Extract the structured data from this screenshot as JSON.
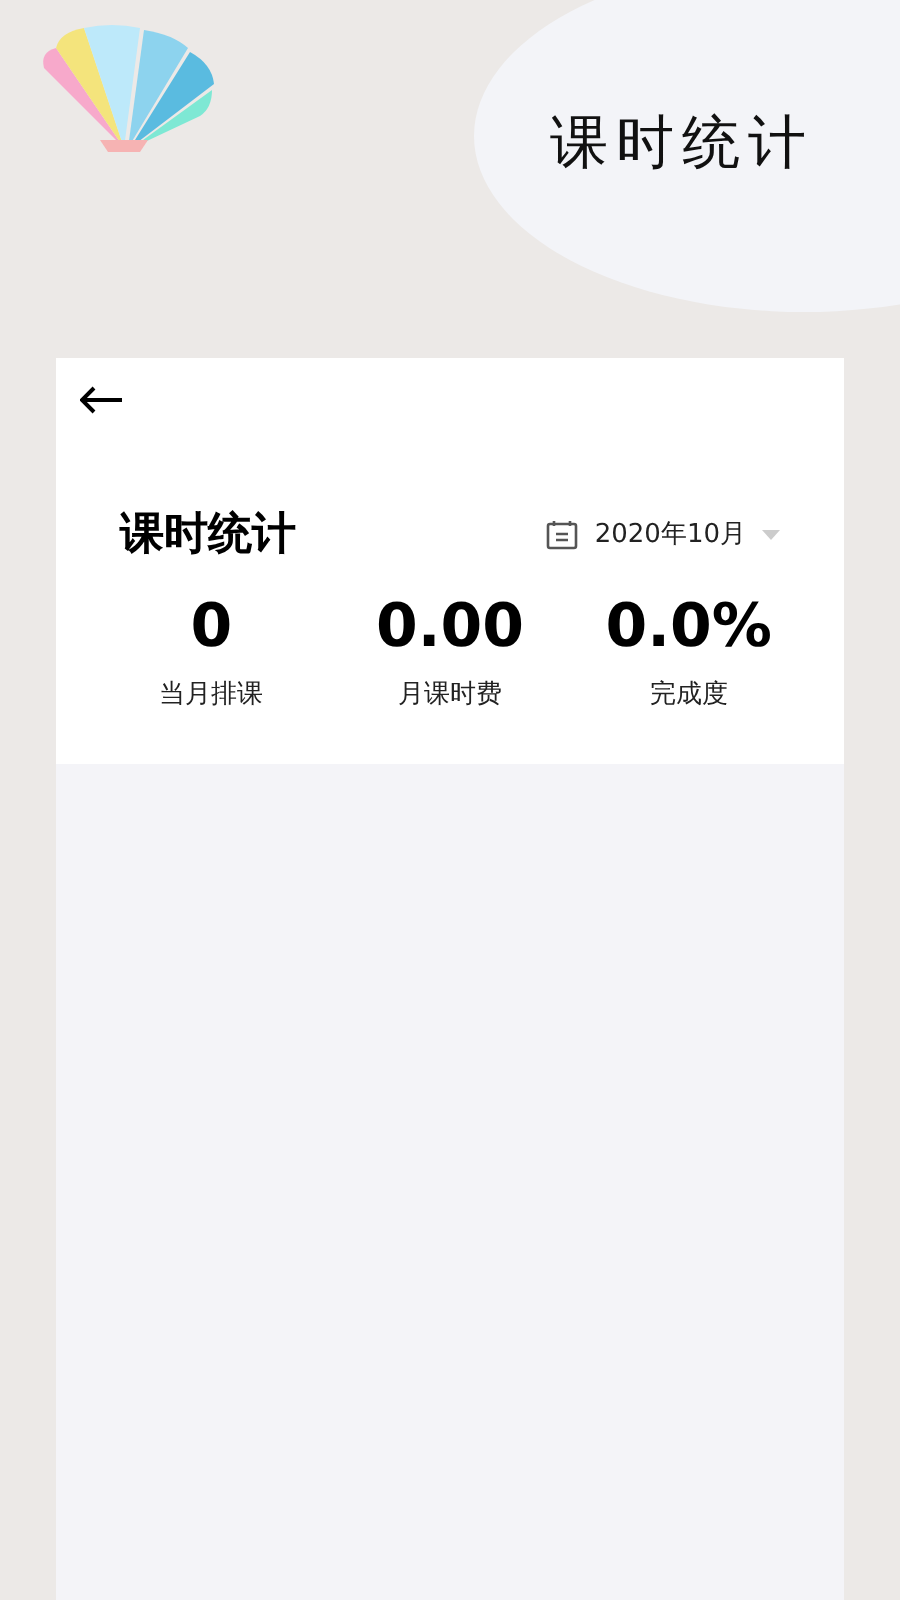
{
  "header": {
    "title": "课时统计"
  },
  "card": {
    "title": "课时统计",
    "month": "2020年10月",
    "stats": [
      {
        "value": "0",
        "label": "当月排课"
      },
      {
        "value": "0.00",
        "label": "月课时费"
      },
      {
        "value": "0.0%",
        "label": "完成度"
      }
    ]
  }
}
